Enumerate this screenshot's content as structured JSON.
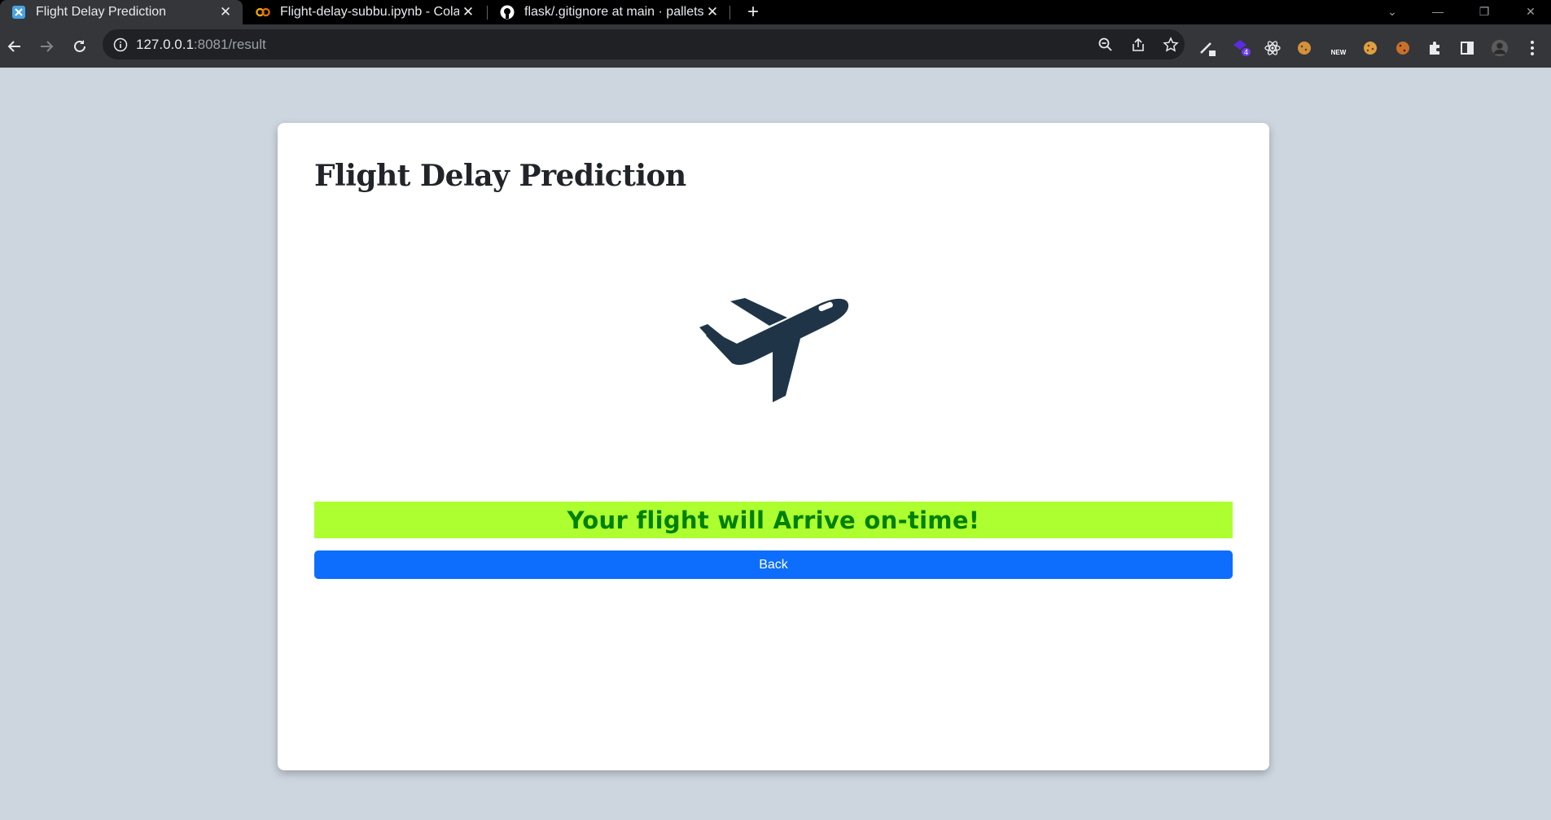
{
  "browser": {
    "tabs": [
      {
        "title": "Flight Delay Prediction",
        "active": true,
        "icon": "flask-app-icon"
      },
      {
        "title": "Flight-delay-subbu.ipynb - Colab",
        "active": false,
        "icon": "colab-icon"
      },
      {
        "title": "flask/.gitignore at main · pallets/f",
        "active": false,
        "icon": "github-icon"
      }
    ],
    "new_tab_label": "+",
    "close_label": "✕",
    "url_host": "127.0.0.1",
    "url_rest": ":8081/result",
    "extension_badge": "4",
    "extension_new_label": "NEW"
  },
  "page": {
    "heading": "Flight Delay Prediction",
    "image_icon": "airplane-icon",
    "result_message": "Your flight will Arrive on-time!",
    "back_label": "Back"
  },
  "colors": {
    "page_background": "#cdd5df",
    "result_background": "#adff2f",
    "result_text": "#008000",
    "button_primary": "#0d6efd",
    "plane": "#1f3547"
  }
}
